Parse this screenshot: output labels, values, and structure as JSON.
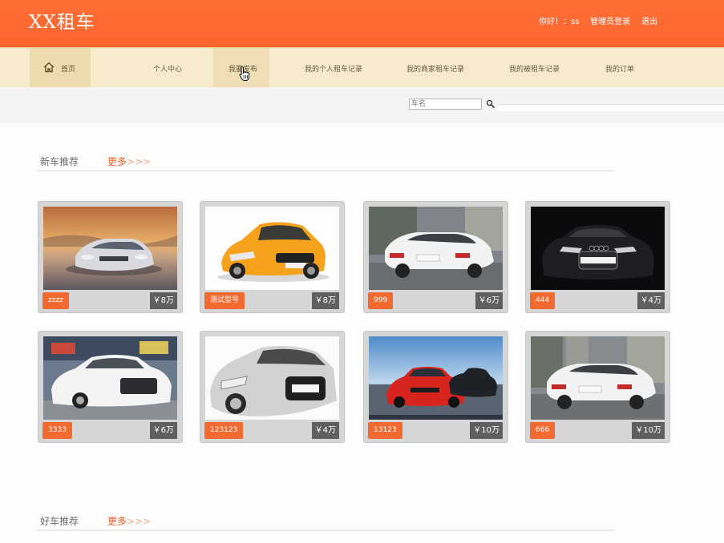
{
  "header": {
    "logo": "XX租车",
    "greeting": "你好！：ss",
    "admin_login": "管理员登录",
    "logout": "退出"
  },
  "nav": {
    "items": [
      {
        "label": "首页",
        "icon": "home-icon"
      },
      {
        "label": "个人中心"
      },
      {
        "label": "我要发布"
      },
      {
        "label": "我的个人租车记录"
      },
      {
        "label": "我的商家租车记录"
      },
      {
        "label": "我的被租车记录"
      },
      {
        "label": "我的订单"
      }
    ]
  },
  "search": {
    "placeholder": "车名",
    "icon": "search-icon"
  },
  "sections": [
    {
      "title": "新车推荐",
      "more": "更多",
      "arrows": ">>>"
    },
    {
      "title": "好车推荐",
      "more": "更多",
      "arrows": ">>>"
    }
  ],
  "cars": [
    {
      "name": "zzzz",
      "price": "￥8万",
      "photo": "silver-sedan-sunset"
    },
    {
      "name": "测试型号",
      "price": "￥8万",
      "photo": "orange-hatchback"
    },
    {
      "name": "999",
      "price": "￥6万",
      "photo": "white-sedan-rear"
    },
    {
      "name": "444",
      "price": "￥4万",
      "photo": "black-convertible"
    },
    {
      "name": "3333",
      "price": "￥6万",
      "photo": "white-luxury-sedan"
    },
    {
      "name": "123123",
      "price": "￥4万",
      "photo": "white-sports-coupe"
    },
    {
      "name": "13123",
      "price": "￥10万",
      "photo": "red-sedan"
    },
    {
      "name": "666",
      "price": "￥10万",
      "photo": "white-sedan-rear"
    }
  ],
  "colors": {
    "accent": "#fb6630",
    "nav_bg": "#f7ebcd",
    "price_bg": "#5f5f5f"
  }
}
